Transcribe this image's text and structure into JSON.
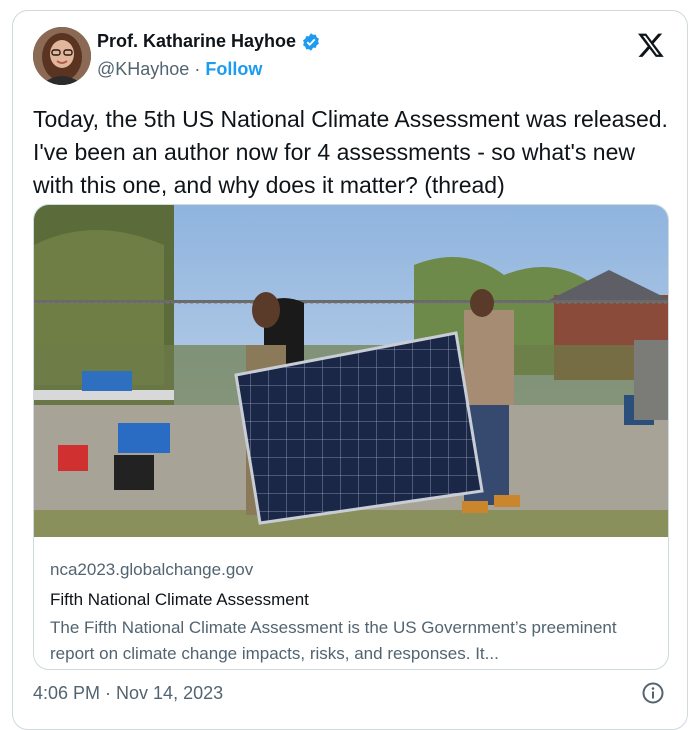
{
  "author": {
    "name": "Prof. Katharine Hayhoe",
    "handle": "@KHayhoe",
    "separator": "·",
    "follow_label": "Follow",
    "verified_icon": "verified-badge-icon",
    "avatar_icon": "profile-photo"
  },
  "brand": {
    "logo_icon": "x-logo-icon"
  },
  "tweet": {
    "text": "Today, the 5th US National Climate Assessment was released. I've been an author now for 4 assessments - so what's new with this one, and why does it matter? (thread)"
  },
  "card": {
    "image_icon": "photo-people-carrying-solar-panel",
    "domain": "nca2023.globalchange.gov",
    "title": "Fifth National Climate Assessment",
    "description": "The Fifth National Climate Assessment is the US Government’s preeminent report on climate change impacts, risks, and responses. It..."
  },
  "footer": {
    "timestamp": "4:06 PM · Nov 14, 2023",
    "info_icon": "info-icon"
  },
  "colors": {
    "accent": "#1d9bf0",
    "text": "#0f1419",
    "secondary": "#536471",
    "border": "#cfd9de"
  }
}
